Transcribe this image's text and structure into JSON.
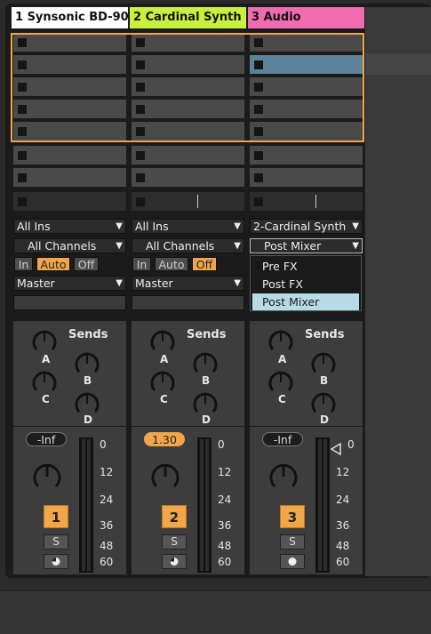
{
  "tracks": [
    {
      "name": "1 Synsonic BD-90",
      "header_bg": "#ffffff",
      "header_fg": "#111111",
      "input_type": "All Ins",
      "input_channel": "All Channels",
      "monitor": {
        "in": "In",
        "auto": "Auto",
        "off": "Off",
        "active": "auto"
      },
      "output": "Master",
      "sends_label": "Sends",
      "send_labels": [
        "A",
        "B",
        "C",
        "D"
      ],
      "volume": "-Inf",
      "volume_active": false,
      "number": "1",
      "solo": "S",
      "arm_icon": "record-arm-icon"
    },
    {
      "name": "2 Cardinal Synth",
      "header_bg": "#c8f03c",
      "header_fg": "#111111",
      "input_type": "All Ins",
      "input_channel": "All Channels",
      "monitor": {
        "in": "In",
        "auto": "Auto",
        "off": "Off",
        "active": "off"
      },
      "output": "Master",
      "sends_label": "Sends",
      "send_labels": [
        "A",
        "B",
        "C",
        "D"
      ],
      "volume": "1.30",
      "volume_active": true,
      "number": "2",
      "solo": "S",
      "arm_icon": "record-arm-icon"
    },
    {
      "name": "3 Audio",
      "header_bg": "#f06bb0",
      "header_fg": "#111111",
      "input_type": "2-Cardinal Synth",
      "input_channel": "Post Mixer",
      "output_menu": [
        "Pre FX",
        "Post FX",
        "Post Mixer"
      ],
      "output_menu_selected": "Post Mixer",
      "sends_label": "Sends",
      "send_labels": [
        "A",
        "B",
        "C",
        "D"
      ],
      "volume": "-Inf",
      "volume_active": false,
      "number": "3",
      "solo": "S",
      "arm_icon": "record-arm-icon"
    }
  ],
  "meter_ticks": [
    "0",
    "12",
    "24",
    "36",
    "48",
    "60"
  ],
  "colors": {
    "accent": "#f0a64a",
    "selected_clip": "#5c8399",
    "menu_highlight": "#b8dbe8"
  }
}
